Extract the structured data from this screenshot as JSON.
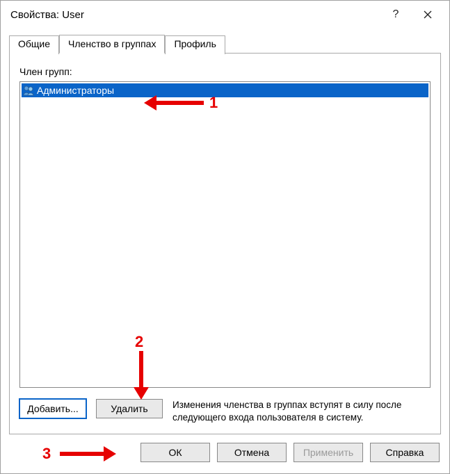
{
  "window": {
    "title": "Свойства: User"
  },
  "tabs": {
    "general": "Общие",
    "membership": "Членство в группах",
    "profile": "Профиль"
  },
  "panel": {
    "label": "Член групп:",
    "items": [
      {
        "name": "Администраторы"
      }
    ],
    "add": "Добавить...",
    "remove": "Удалить",
    "note": "Изменения членства в группах вступят в силу после следующего входа пользователя в систему."
  },
  "footer": {
    "ok": "ОК",
    "cancel": "Отмена",
    "apply": "Применить",
    "help": "Справка"
  },
  "annotations": {
    "n1": "1",
    "n2": "2",
    "n3": "3"
  }
}
